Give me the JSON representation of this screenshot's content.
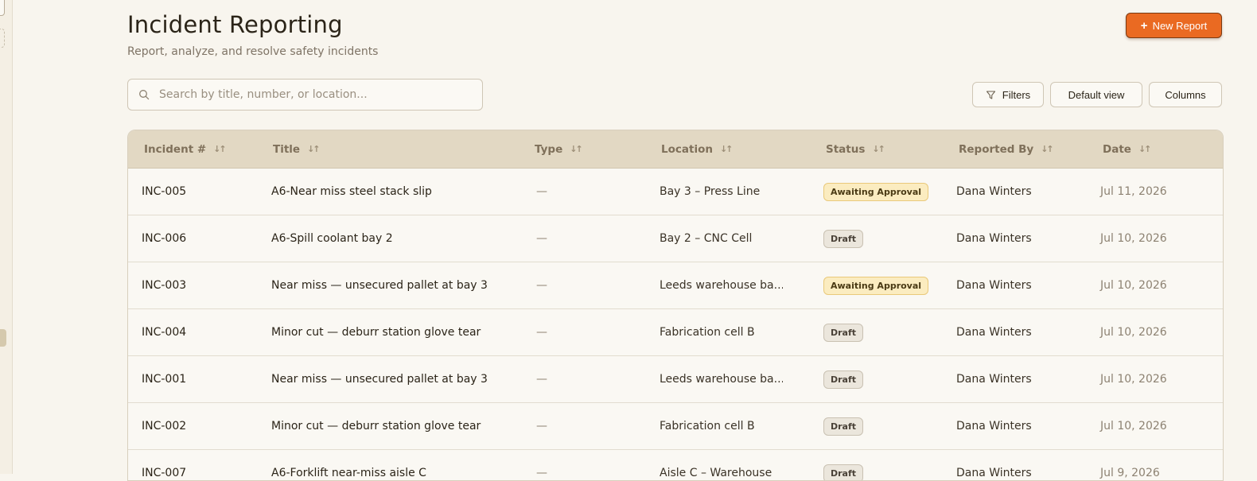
{
  "page": {
    "title": "Incident Reporting",
    "subtitle": "Report, analyze, and resolve safety incidents"
  },
  "actions": {
    "new_report_label": "New Report",
    "new_report_icon": "plus-icon"
  },
  "search": {
    "placeholder": "Search by title, number, or location...",
    "value": ""
  },
  "toolbar": {
    "filters_label": "Filters",
    "default_view_label": "Default view",
    "columns_label": "Columns"
  },
  "table": {
    "columns": [
      "Incident #",
      "Title",
      "Type",
      "Location",
      "Status",
      "Reported By",
      "Date"
    ],
    "rows": [
      {
        "id": "INC-005",
        "title": "A6-Near miss steel stack slip",
        "type": "—",
        "location": "Bay 3 – Press Line",
        "status": "Awaiting Approval",
        "status_kind": "awaiting",
        "reported_by": "Dana Winters",
        "date": "Jul 11, 2026"
      },
      {
        "id": "INC-006",
        "title": "A6-Spill coolant bay 2",
        "type": "—",
        "location": "Bay 2 – CNC Cell",
        "status": "Draft",
        "status_kind": "draft",
        "reported_by": "Dana Winters",
        "date": "Jul 10, 2026"
      },
      {
        "id": "INC-003",
        "title": "Near miss — unsecured pallet at bay 3",
        "type": "—",
        "location": "Leeds warehouse ba...",
        "status": "Awaiting Approval",
        "status_kind": "awaiting",
        "reported_by": "Dana Winters",
        "date": "Jul 10, 2026"
      },
      {
        "id": "INC-004",
        "title": "Minor cut — deburr station glove tear",
        "type": "—",
        "location": "Fabrication cell B",
        "status": "Draft",
        "status_kind": "draft",
        "reported_by": "Dana Winters",
        "date": "Jul 10, 2026"
      },
      {
        "id": "INC-001",
        "title": "Near miss — unsecured pallet at bay 3",
        "type": "—",
        "location": "Leeds warehouse ba...",
        "status": "Draft",
        "status_kind": "draft",
        "reported_by": "Dana Winters",
        "date": "Jul 10, 2026"
      },
      {
        "id": "INC-002",
        "title": "Minor cut — deburr station glove tear",
        "type": "—",
        "location": "Fabrication cell B",
        "status": "Draft",
        "status_kind": "draft",
        "reported_by": "Dana Winters",
        "date": "Jul 10, 2026"
      },
      {
        "id": "INC-007",
        "title": "A6-Forklift near-miss aisle C",
        "type": "—",
        "location": "Aisle C – Warehouse",
        "status": "Draft",
        "status_kind": "draft",
        "reported_by": "Dana Winters",
        "date": "Jul 9, 2026"
      }
    ]
  },
  "colors": {
    "accent": "#ea6a22",
    "background": "#f8f5ee",
    "table_header": "#e2d8c3",
    "awaiting_badge": "#fbecc0",
    "draft_badge": "#ebe6dc"
  }
}
